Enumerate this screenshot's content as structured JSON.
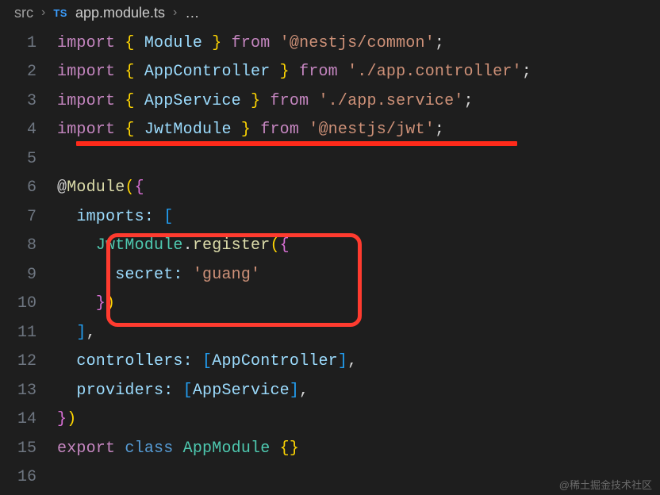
{
  "breadcrumb": {
    "parent": "src",
    "badge": "TS",
    "file": "app.module.ts",
    "trailing": "…"
  },
  "lines": {
    "l1": {
      "num": "1",
      "import": "import",
      "lb": "{",
      "name": "Module",
      "rb": "}",
      "from": "from",
      "str": "'@nestjs/common'",
      "semi": ";"
    },
    "l2": {
      "num": "2",
      "import": "import",
      "lb": "{",
      "name": "AppController",
      "rb": "}",
      "from": "from",
      "str": "'./app.controller'",
      "semi": ";"
    },
    "l3": {
      "num": "3",
      "import": "import",
      "lb": "{",
      "name": "AppService",
      "rb": "}",
      "from": "from",
      "str": "'./app.service'",
      "semi": ";"
    },
    "l4": {
      "num": "4",
      "import": "import",
      "lb": "{",
      "name": "JwtModule",
      "rb": "}",
      "from": "from",
      "str": "'@nestjs/jwt'",
      "semi": ";"
    },
    "l5": {
      "num": "5"
    },
    "l6": {
      "num": "6",
      "decor": "@",
      "dname": "Module",
      "lp": "(",
      "lb": "{"
    },
    "l7": {
      "num": "7",
      "key": "imports:",
      "lb": "["
    },
    "l8": {
      "num": "8",
      "obj": "JwtModule",
      "dot": ".",
      "method": "register",
      "lp": "(",
      "lb": "{"
    },
    "l9": {
      "num": "9",
      "key": "secret:",
      "str": "'guang'"
    },
    "l10": {
      "num": "10",
      "rb": "}",
      "rp": ")"
    },
    "l11": {
      "num": "11",
      "rb": "]",
      "comma": ","
    },
    "l12": {
      "num": "12",
      "key": "controllers:",
      "lb": "[",
      "val": "AppController",
      "rb": "]",
      "comma": ","
    },
    "l13": {
      "num": "13",
      "key": "providers:",
      "lb": "[",
      "val": "AppService",
      "rb": "]",
      "comma": ","
    },
    "l14": {
      "num": "14",
      "rb": "}",
      "rp": ")"
    },
    "l15": {
      "num": "15",
      "export": "export",
      "class": "class",
      "name": "AppModule",
      "lb": "{",
      "rb": "}"
    },
    "l16": {
      "num": "16"
    }
  },
  "watermark": "@稀土掘金技术社区",
  "annotations": {
    "underline_line": 4,
    "box_lines": [
      8,
      9,
      10
    ]
  },
  "colors": {
    "background": "#1e1e1e",
    "keyword": "#c586c0",
    "type": "#4ec9b0",
    "string": "#ce9178",
    "identifier": "#9cdcfe",
    "method": "#dcdcaa",
    "annotation_red": "#ff3b2f"
  }
}
